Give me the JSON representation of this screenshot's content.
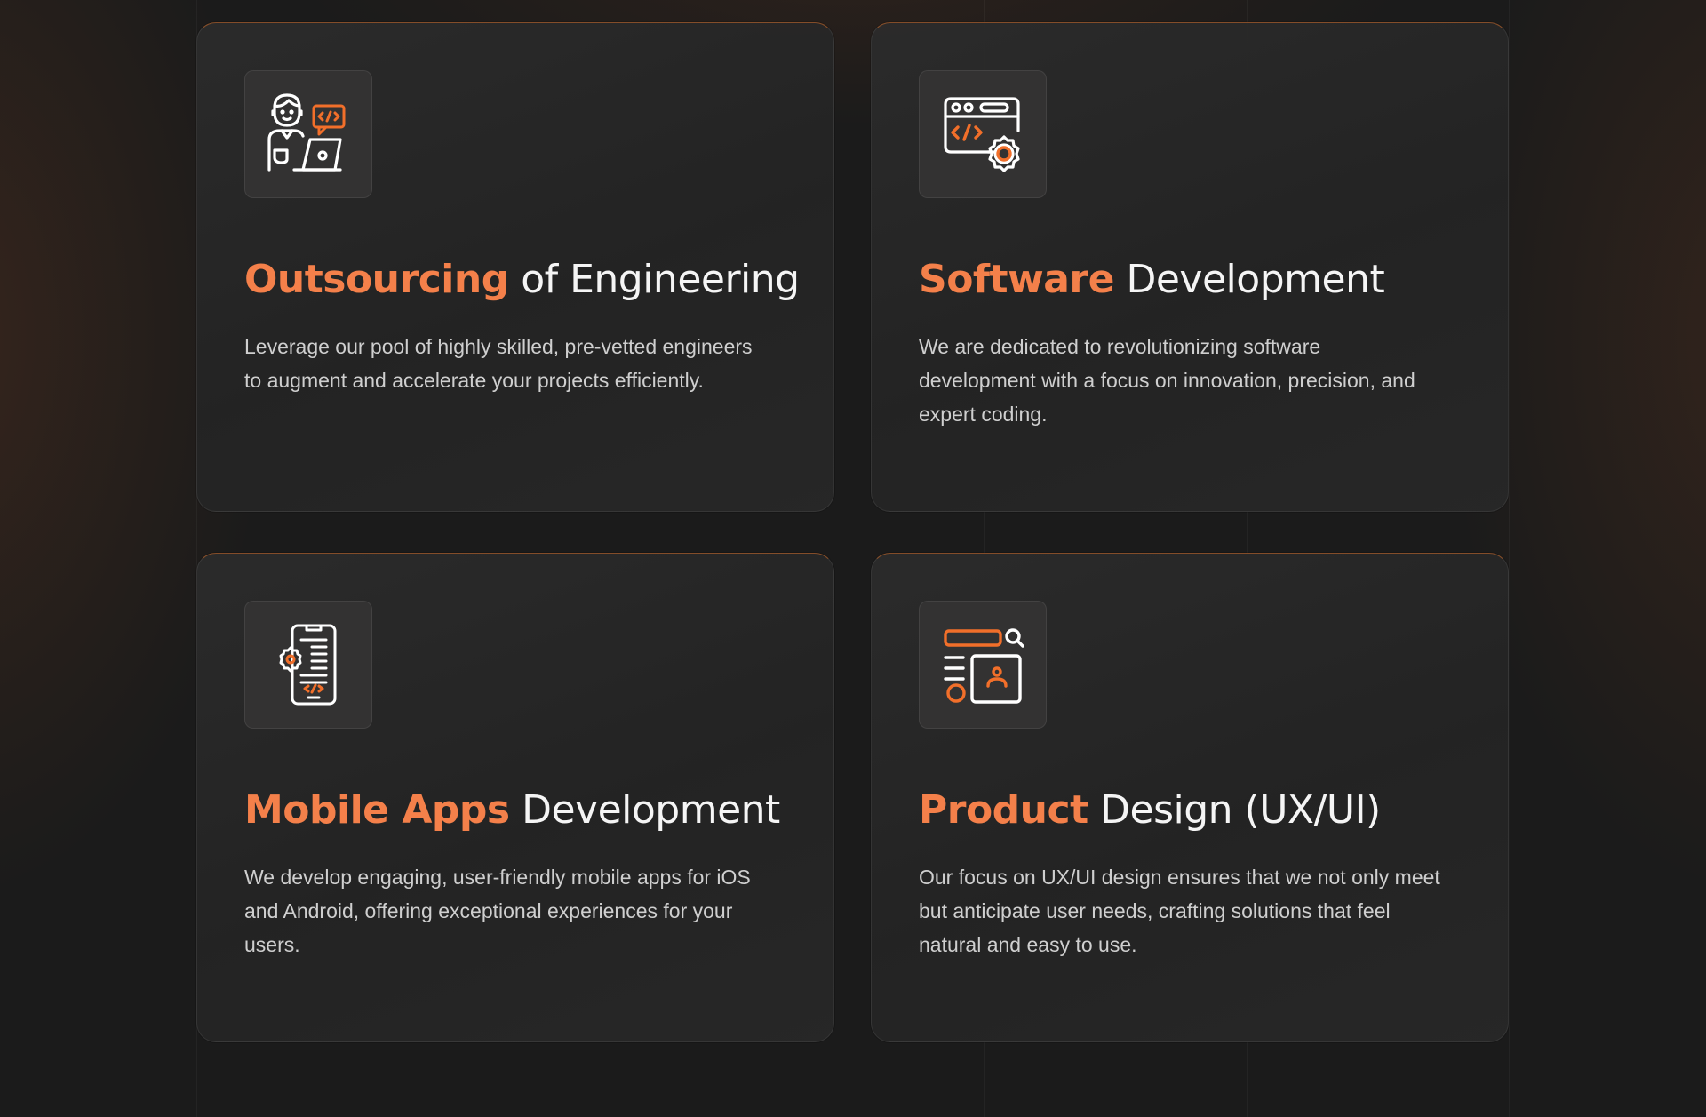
{
  "colors": {
    "accent": "#f4804a",
    "icon_stroke": "#ffffff",
    "icon_accent": "#f26f2a",
    "card_bg": "#2a2a2a",
    "page_bg": "#1b1b1b"
  },
  "services": [
    {
      "icon": "engineer-laptop-icon",
      "title_accent": "Outsourcing",
      "title_rest": "of Engineering",
      "description": "Leverage our pool of highly skilled, pre-vetted engineers to augment and accelerate your projects efficiently."
    },
    {
      "icon": "code-window-gear-icon",
      "title_accent": "Software",
      "title_rest": "Development",
      "description": "We are dedicated to revolutionizing software development with a focus on innovation, precision, and expert coding."
    },
    {
      "icon": "mobile-app-gear-icon",
      "title_accent": "Mobile Apps",
      "title_rest": "Development",
      "description": "We develop engaging, user-friendly mobile apps for iOS and Android, offering exceptional experiences for your users."
    },
    {
      "icon": "ux-layout-search-icon",
      "title_accent": "Product",
      "title_rest": "Design (UX/UI)",
      "description": "Our focus on UX/UI design ensures that we not only meet but anticipate user needs, crafting solutions that feel natural and easy to use."
    }
  ]
}
